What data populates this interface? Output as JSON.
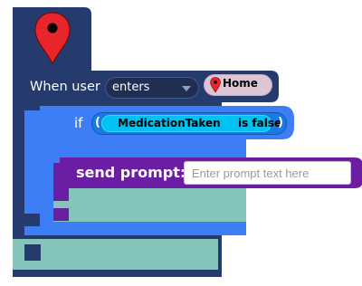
{
  "when_block": {
    "label": "When user",
    "event_value": "enters",
    "location_value": "Home"
  },
  "if_block": {
    "label": "if",
    "paren_open": "(",
    "paren_close": ")",
    "variable": "MedicationTaken",
    "operator": "is false"
  },
  "send_block": {
    "label": "send prompt:",
    "placeholder": "Enter prompt text here"
  },
  "colors": {
    "event_block": "#253b6d",
    "if_block": "#3d7ef6",
    "send_block": "#6b1ea3",
    "empty_slot": "#84c4bb",
    "condition": "#1b7ae0",
    "variable": "#00c2f1",
    "location_chip": "#dcc6d6",
    "pin": "#e8252a"
  },
  "icons": {
    "header": "map-pin-icon",
    "chip": "map-pin-icon",
    "dropdown": "chevron-down-icon"
  }
}
